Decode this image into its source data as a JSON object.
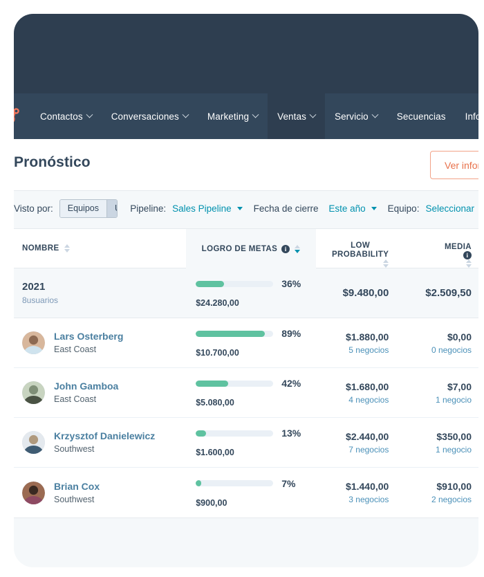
{
  "app": {
    "logo": "hubspot-sprocket-logo"
  },
  "nav": {
    "items": [
      {
        "label": "Contactos",
        "caret": true,
        "active": false
      },
      {
        "label": "Conversaciones",
        "caret": true,
        "active": false
      },
      {
        "label": "Marketing",
        "caret": true,
        "active": false
      },
      {
        "label": "Ventas",
        "caret": true,
        "active": true
      },
      {
        "label": "Servicio",
        "caret": true,
        "active": false
      },
      {
        "label": "Secuencias",
        "caret": false,
        "active": false
      },
      {
        "label": "Informes",
        "caret": true,
        "active": false
      }
    ]
  },
  "header": {
    "title": "Pronóstico",
    "action_button": "Ver informe"
  },
  "filters": {
    "view_by_label": "Visto por:",
    "segment": {
      "options": [
        "Equipos",
        "Usuarios"
      ],
      "selected": "Usuarios"
    },
    "pipeline_label": "Pipeline:",
    "pipeline_value": "Sales Pipeline",
    "close_date_label": "Fecha de cierre",
    "close_date_value": "Este año",
    "team_label": "Equipo:",
    "team_value": "Seleccionar"
  },
  "table": {
    "columns": [
      {
        "key": "name",
        "label": "NOMBRE",
        "info": false,
        "sorted": false
      },
      {
        "key": "goal",
        "label": "LOGRO DE METAS",
        "info": true,
        "sorted": true
      },
      {
        "key": "low",
        "label_line1": "LOW",
        "label_line2": "PROBABILITY",
        "info": false,
        "sorted": false
      },
      {
        "key": "media",
        "label": "MEDIA",
        "info": true,
        "sorted": false
      }
    ],
    "summary_row": {
      "title": "2021",
      "subtitle": "8usuarios",
      "goal_percent": "36%",
      "goal_fill": 36,
      "goal_amount": "$24.280,00",
      "low_amount": "$9.480,00",
      "media_amount": "$2.509,50"
    },
    "rows": [
      {
        "name": "Lars Osterberg",
        "team": "East Coast",
        "avatar": "avatar-lars",
        "avatar_colors": [
          "#8d6a52",
          "#d8b79c",
          "#cfe3ee"
        ],
        "goal_percent": "89%",
        "goal_fill": 89,
        "goal_amount": "$10.700,00",
        "low_amount": "$1.880,00",
        "low_deals": "5 negocios",
        "media_amount": "$0,00",
        "media_deals": "0 negocios"
      },
      {
        "name": "John Gamboa",
        "team": "East Coast",
        "avatar": "avatar-john",
        "avatar_colors": [
          "#7f8f77",
          "#c8d4c0",
          "#4a5344"
        ],
        "goal_percent": "42%",
        "goal_fill": 42,
        "goal_amount": "$5.080,00",
        "low_amount": "$1.680,00",
        "low_deals": "4 negocios",
        "media_amount": "$7,00",
        "media_deals": "1 negocio"
      },
      {
        "name": "Krzysztof Danielewicz",
        "team": "Southwest",
        "avatar": "avatar-krzysztof",
        "avatar_colors": [
          "#b09a7e",
          "#e4e9ee",
          "#3f5c73"
        ],
        "goal_percent": "13%",
        "goal_fill": 13,
        "goal_amount": "$1.600,00",
        "low_amount": "$2.440,00",
        "low_deals": "7 negocios",
        "media_amount": "$350,00",
        "media_deals": "1 negocio"
      },
      {
        "name": "Brian Cox",
        "team": "Southwest",
        "avatar": "avatar-brian",
        "avatar_colors": [
          "#3a2a22",
          "#9b6b52",
          "#8e4a62"
        ],
        "goal_percent": "7%",
        "goal_fill": 7,
        "goal_amount": "$900,00",
        "low_amount": "$1.440,00",
        "low_deals": "3 negocios",
        "media_amount": "$910,00",
        "media_deals": "2 negocios"
      }
    ]
  },
  "colors": {
    "nav_dark": "#33475b",
    "panel_dark": "#2e3e50",
    "accent_orange": "#e8704a",
    "link_teal": "#0091ae",
    "progress_green": "#5fc2a0",
    "page_bg": "#f5f8fa"
  }
}
